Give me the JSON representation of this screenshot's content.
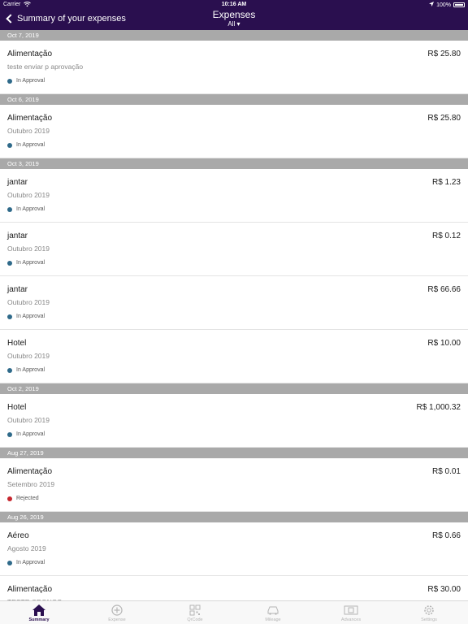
{
  "colors": {
    "header_bg": "#2a0f4f",
    "section_bg": "#a9a9a9",
    "status_approval": "#2f6a8a",
    "status_rejected": "#c6262e",
    "tab_active": "#2a0f4f",
    "tab_inactive": "#b5b5b5"
  },
  "status_bar": {
    "carrier": "Carrier",
    "time": "10:16 AM",
    "battery": "100%"
  },
  "nav": {
    "back_label": "Summary of your expenses",
    "title": "Expenses",
    "filter": "All ▾"
  },
  "sections": [
    {
      "date": "Oct 7, 2019",
      "items": [
        {
          "name": "Alimentação",
          "amount": "R$ 25.80",
          "desc": "teste enviar p aprovação",
          "status": "In Approval",
          "status_color": "#2f6a8a"
        }
      ]
    },
    {
      "date": "Oct 6, 2019",
      "items": [
        {
          "name": "Alimentação",
          "amount": "R$ 25.80",
          "desc": "Outubro 2019",
          "status": "In Approval",
          "status_color": "#2f6a8a"
        }
      ]
    },
    {
      "date": "Oct 3, 2019",
      "items": [
        {
          "name": "jantar",
          "amount": "R$ 1.23",
          "desc": "Outubro 2019",
          "status": "In Approval",
          "status_color": "#2f6a8a"
        },
        {
          "name": "jantar",
          "amount": "R$ 0.12",
          "desc": "Outubro 2019",
          "status": "In Approval",
          "status_color": "#2f6a8a"
        },
        {
          "name": "jantar",
          "amount": "R$ 66.66",
          "desc": "Outubro 2019",
          "status": "In Approval",
          "status_color": "#2f6a8a"
        },
        {
          "name": "Hotel",
          "amount": "R$ 10.00",
          "desc": "Outubro 2019",
          "status": "In Approval",
          "status_color": "#2f6a8a"
        }
      ]
    },
    {
      "date": "Oct 2, 2019",
      "items": [
        {
          "name": "Hotel",
          "amount": "R$ 1,000.32",
          "desc": "Outubro 2019",
          "status": "In Approval",
          "status_color": "#2f6a8a"
        }
      ]
    },
    {
      "date": "Aug 27, 2019",
      "items": [
        {
          "name": "Alimentação",
          "amount": "R$ 0.01",
          "desc": "Setembro 2019",
          "status": "Rejected",
          "status_color": "#c6262e"
        }
      ]
    },
    {
      "date": "Aug 26, 2019",
      "items": [
        {
          "name": "Aéreo",
          "amount": "R$ 0.66",
          "desc": "Agosto 2019",
          "status": "In Approval",
          "status_color": "#2f6a8a"
        },
        {
          "name": "Alimentação",
          "amount": "R$ 30.00",
          "desc": "TESTE CRONOS",
          "status": "",
          "status_color": "#2f6a8a"
        }
      ]
    }
  ],
  "tabs": [
    {
      "label": "Summary",
      "icon": "home-icon",
      "active": true
    },
    {
      "label": "Expense",
      "icon": "plus-circle-icon",
      "active": false
    },
    {
      "label": "QrCode",
      "icon": "qrcode-icon",
      "active": false
    },
    {
      "label": "Mileage",
      "icon": "car-icon",
      "active": false
    },
    {
      "label": "Advances",
      "icon": "money-icon",
      "active": false
    },
    {
      "label": "Settings",
      "icon": "gear-icon",
      "active": false
    }
  ]
}
